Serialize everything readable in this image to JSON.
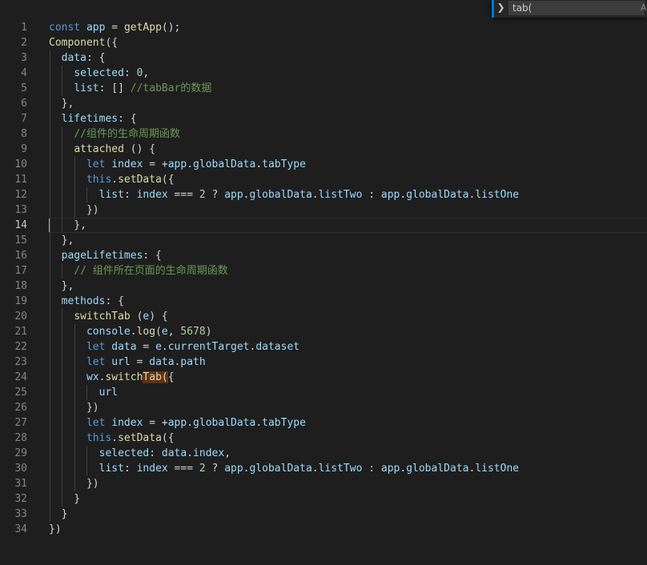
{
  "find_widget": {
    "toggle_icon": "chevron-right-icon",
    "query": "tab(",
    "match_case_glyph": "A"
  },
  "editor": {
    "current_line": 14,
    "lines": [
      {
        "n": "1",
        "indent": 0,
        "tokens": [
          [
            "kw",
            "const"
          ],
          [
            "pl",
            " "
          ],
          [
            "var",
            "app"
          ],
          [
            "pl",
            " = "
          ],
          [
            "fn",
            "getApp"
          ],
          [
            "pl",
            "();"
          ]
        ]
      },
      {
        "n": "2",
        "indent": 0,
        "tokens": [
          [
            "fn",
            "Component"
          ],
          [
            "pl",
            "({"
          ]
        ]
      },
      {
        "n": "3",
        "indent": 1,
        "tokens": [
          [
            "pl",
            "  "
          ],
          [
            "var",
            "data"
          ],
          [
            "pl",
            ": {"
          ]
        ]
      },
      {
        "n": "4",
        "indent": 2,
        "tokens": [
          [
            "pl",
            "    "
          ],
          [
            "var",
            "selected"
          ],
          [
            "pl",
            ": "
          ],
          [
            "num",
            "0"
          ],
          [
            "pl",
            ","
          ]
        ]
      },
      {
        "n": "5",
        "indent": 2,
        "tokens": [
          [
            "pl",
            "    "
          ],
          [
            "var",
            "list"
          ],
          [
            "pl",
            ": [] "
          ],
          [
            "cm",
            "//tabBar的数据"
          ]
        ]
      },
      {
        "n": "6",
        "indent": 1,
        "tokens": [
          [
            "pl",
            "  },"
          ]
        ]
      },
      {
        "n": "7",
        "indent": 1,
        "tokens": [
          [
            "pl",
            "  "
          ],
          [
            "var",
            "lifetimes"
          ],
          [
            "pl",
            ": {"
          ]
        ]
      },
      {
        "n": "8",
        "indent": 2,
        "tokens": [
          [
            "pl",
            "    "
          ],
          [
            "cm",
            "//组件的生命周期函数"
          ]
        ]
      },
      {
        "n": "9",
        "indent": 2,
        "fold": true,
        "tokens": [
          [
            "pl",
            "    "
          ],
          [
            "fn",
            "attached"
          ],
          [
            "pl",
            " () {"
          ]
        ]
      },
      {
        "n": "10",
        "indent": 3,
        "tokens": [
          [
            "pl",
            "      "
          ],
          [
            "kw",
            "let"
          ],
          [
            "pl",
            " "
          ],
          [
            "var",
            "index"
          ],
          [
            "pl",
            " = +"
          ],
          [
            "var",
            "app"
          ],
          [
            "pl",
            "."
          ],
          [
            "var",
            "globalData"
          ],
          [
            "pl",
            "."
          ],
          [
            "var",
            "tabType"
          ]
        ]
      },
      {
        "n": "11",
        "indent": 3,
        "tokens": [
          [
            "pl",
            "      "
          ],
          [
            "kw",
            "this"
          ],
          [
            "pl",
            "."
          ],
          [
            "fn",
            "setData"
          ],
          [
            "pl",
            "({"
          ]
        ]
      },
      {
        "n": "12",
        "indent": 4,
        "tokens": [
          [
            "pl",
            "        "
          ],
          [
            "var",
            "list"
          ],
          [
            "pl",
            ": "
          ],
          [
            "var",
            "index"
          ],
          [
            "pl",
            " === "
          ],
          [
            "num",
            "2"
          ],
          [
            "pl",
            " ? "
          ],
          [
            "var",
            "app"
          ],
          [
            "pl",
            "."
          ],
          [
            "var",
            "globalData"
          ],
          [
            "pl",
            "."
          ],
          [
            "var",
            "listTwo"
          ],
          [
            "pl",
            " : "
          ],
          [
            "var",
            "app"
          ],
          [
            "pl",
            "."
          ],
          [
            "var",
            "globalData"
          ],
          [
            "pl",
            "."
          ],
          [
            "var",
            "listOne"
          ]
        ]
      },
      {
        "n": "13",
        "indent": 3,
        "fold": true,
        "tokens": [
          [
            "pl",
            "      })"
          ]
        ]
      },
      {
        "n": "14",
        "indent": 2,
        "tokens": [
          [
            "pl",
            "    },"
          ]
        ]
      },
      {
        "n": "15",
        "indent": 1,
        "tokens": [
          [
            "pl",
            "  },"
          ]
        ]
      },
      {
        "n": "16",
        "indent": 1,
        "tokens": [
          [
            "pl",
            "  "
          ],
          [
            "var",
            "pageLifetimes"
          ],
          [
            "pl",
            ": {"
          ]
        ]
      },
      {
        "n": "17",
        "indent": 2,
        "tokens": [
          [
            "pl",
            "    "
          ],
          [
            "cm",
            "// 组件所在页面的生命周期函数"
          ]
        ]
      },
      {
        "n": "18",
        "indent": 1,
        "fold": true,
        "tokens": [
          [
            "pl",
            "  },"
          ]
        ]
      },
      {
        "n": "19",
        "indent": 1,
        "tokens": [
          [
            "pl",
            "  "
          ],
          [
            "var",
            "methods"
          ],
          [
            "pl",
            ": {"
          ]
        ]
      },
      {
        "n": "20",
        "indent": 2,
        "tokens": [
          [
            "pl",
            "    "
          ],
          [
            "fn",
            "switchTab"
          ],
          [
            "pl",
            " ("
          ],
          [
            "var",
            "e"
          ],
          [
            "pl",
            ") {"
          ]
        ]
      },
      {
        "n": "21",
        "indent": 3,
        "tokens": [
          [
            "pl",
            "      "
          ],
          [
            "var",
            "console"
          ],
          [
            "pl",
            "."
          ],
          [
            "fn",
            "log"
          ],
          [
            "pl",
            "("
          ],
          [
            "var",
            "e"
          ],
          [
            "pl",
            ", "
          ],
          [
            "num",
            "5678"
          ],
          [
            "pl",
            ")"
          ]
        ]
      },
      {
        "n": "22",
        "indent": 3,
        "tokens": [
          [
            "pl",
            "      "
          ],
          [
            "kw",
            "let"
          ],
          [
            "pl",
            " "
          ],
          [
            "var",
            "data"
          ],
          [
            "pl",
            " = "
          ],
          [
            "var",
            "e"
          ],
          [
            "pl",
            "."
          ],
          [
            "var",
            "currentTarget"
          ],
          [
            "pl",
            "."
          ],
          [
            "var",
            "dataset"
          ]
        ]
      },
      {
        "n": "23",
        "indent": 3,
        "tokens": [
          [
            "pl",
            "      "
          ],
          [
            "kw",
            "let"
          ],
          [
            "pl",
            " "
          ],
          [
            "var",
            "url"
          ],
          [
            "pl",
            " = "
          ],
          [
            "var",
            "data"
          ],
          [
            "pl",
            "."
          ],
          [
            "var",
            "path"
          ]
        ]
      },
      {
        "n": "24",
        "indent": 3,
        "tokens": [
          [
            "pl",
            "      "
          ],
          [
            "var",
            "wx"
          ],
          [
            "pl",
            "."
          ],
          [
            "fn",
            "switch"
          ],
          [
            "fnhl",
            "Tab("
          ],
          [
            "pl",
            "{"
          ]
        ]
      },
      {
        "n": "25",
        "indent": 4,
        "tokens": [
          [
            "pl",
            "        "
          ],
          [
            "var",
            "url"
          ]
        ]
      },
      {
        "n": "26",
        "indent": 3,
        "tokens": [
          [
            "pl",
            "      })"
          ]
        ]
      },
      {
        "n": "27",
        "indent": 3,
        "tokens": [
          [
            "pl",
            "      "
          ],
          [
            "kw",
            "let"
          ],
          [
            "pl",
            " "
          ],
          [
            "var",
            "index"
          ],
          [
            "pl",
            " = +"
          ],
          [
            "var",
            "app"
          ],
          [
            "pl",
            "."
          ],
          [
            "var",
            "globalData"
          ],
          [
            "pl",
            "."
          ],
          [
            "var",
            "tabType"
          ]
        ]
      },
      {
        "n": "28",
        "indent": 3,
        "fold": true,
        "tokens": [
          [
            "pl",
            "      "
          ],
          [
            "kw",
            "this"
          ],
          [
            "pl",
            "."
          ],
          [
            "fn",
            "setData"
          ],
          [
            "pl",
            "({"
          ]
        ]
      },
      {
        "n": "29",
        "indent": 4,
        "tokens": [
          [
            "pl",
            "        "
          ],
          [
            "var",
            "selected"
          ],
          [
            "pl",
            ": "
          ],
          [
            "var",
            "data"
          ],
          [
            "pl",
            "."
          ],
          [
            "var",
            "index"
          ],
          [
            "pl",
            ","
          ]
        ]
      },
      {
        "n": "30",
        "indent": 4,
        "tokens": [
          [
            "pl",
            "        "
          ],
          [
            "var",
            "list"
          ],
          [
            "pl",
            ": "
          ],
          [
            "var",
            "index"
          ],
          [
            "pl",
            " === "
          ],
          [
            "num",
            "2"
          ],
          [
            "pl",
            " ? "
          ],
          [
            "var",
            "app"
          ],
          [
            "pl",
            "."
          ],
          [
            "var",
            "globalData"
          ],
          [
            "pl",
            "."
          ],
          [
            "var",
            "listTwo"
          ],
          [
            "pl",
            " : "
          ],
          [
            "var",
            "app"
          ],
          [
            "pl",
            "."
          ],
          [
            "var",
            "globalData"
          ],
          [
            "pl",
            "."
          ],
          [
            "var",
            "listOne"
          ]
        ]
      },
      {
        "n": "31",
        "indent": 3,
        "tokens": [
          [
            "pl",
            "      })"
          ]
        ]
      },
      {
        "n": "32",
        "indent": 2,
        "fold": true,
        "tokens": [
          [
            "pl",
            "    }"
          ]
        ]
      },
      {
        "n": "33",
        "indent": 1,
        "tokens": [
          [
            "pl",
            "  }"
          ]
        ]
      },
      {
        "n": "34",
        "indent": 0,
        "tokens": [
          [
            "pl",
            "})"
          ]
        ]
      }
    ]
  }
}
